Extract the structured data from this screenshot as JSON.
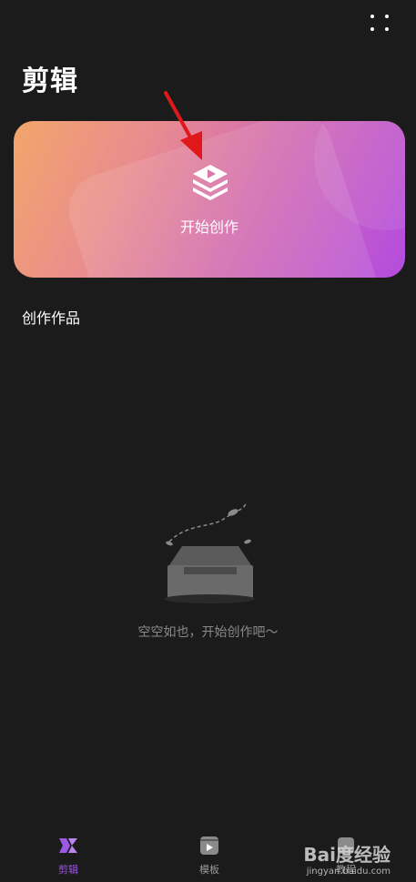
{
  "header": {
    "title": "剪辑",
    "menu_icon": "more-dots-icon"
  },
  "hero": {
    "label": "开始创作",
    "icon": "layered-play-icon",
    "gradient_colors": [
      "#f2a56a",
      "#d26bb0",
      "#b44ce0"
    ]
  },
  "annotation": {
    "arrow_color": "#e0181a"
  },
  "works": {
    "title": "创作作品",
    "empty_text": "空空如也，开始创作吧～",
    "empty_icon": "empty-inbox-icon"
  },
  "bottom_nav": {
    "items": [
      {
        "label": "剪辑",
        "icon": "edit-logo-icon",
        "active": true
      },
      {
        "label": "模板",
        "icon": "template-film-icon",
        "active": false
      },
      {
        "label": "教程",
        "icon": "tutorial-icon",
        "active": false
      }
    ],
    "accent_color": "#9b59e6"
  },
  "watermark": {
    "brand": "Bai度经验",
    "url": "jingyan.baidu.com"
  }
}
